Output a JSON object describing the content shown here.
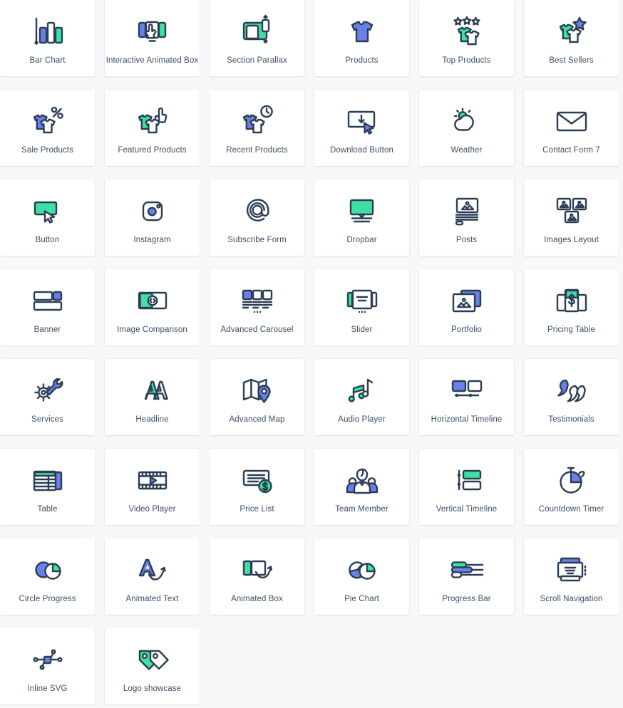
{
  "palette": {
    "page_background": "#f7f8fa",
    "card_background": "#ffffff",
    "stroke": "#2c3e55",
    "blue": "#6b7fe8",
    "green": "#3ee0a5",
    "label_text": "#3d4f66"
  },
  "grid": {
    "columns": 6,
    "card_count": 44
  },
  "cards": [
    {
      "label": "Bar Chart",
      "icon": "bar-chart-icon"
    },
    {
      "label": "Interactive Animated Box",
      "icon": "interactive-animated-box-icon"
    },
    {
      "label": "Section Parallax",
      "icon": "section-parallax-icon"
    },
    {
      "label": "Products",
      "icon": "products-tshirt-icon"
    },
    {
      "label": "Top Products",
      "icon": "top-products-stars-icon"
    },
    {
      "label": "Best Sellers",
      "icon": "best-sellers-star-icon"
    },
    {
      "label": "Sale Products",
      "icon": "sale-products-percent-icon"
    },
    {
      "label": "Featured Products",
      "icon": "featured-products-thumbsup-icon"
    },
    {
      "label": "Recent Products",
      "icon": "recent-products-clock-icon"
    },
    {
      "label": "Download Button",
      "icon": "download-button-icon"
    },
    {
      "label": "Weather",
      "icon": "weather-sun-cloud-icon"
    },
    {
      "label": "Contact Form 7",
      "icon": "envelope-icon"
    },
    {
      "label": "Button",
      "icon": "button-cursor-icon"
    },
    {
      "label": "Instagram",
      "icon": "instagram-camera-icon"
    },
    {
      "label": "Subscribe Form",
      "icon": "at-sign-icon"
    },
    {
      "label": "Dropbar",
      "icon": "dropbar-screen-icon"
    },
    {
      "label": "Posts",
      "icon": "posts-icon"
    },
    {
      "label": "Images Layout",
      "icon": "images-layout-icon"
    },
    {
      "label": "Banner",
      "icon": "banner-icon"
    },
    {
      "label": "Image Comparison",
      "icon": "image-comparison-icon"
    },
    {
      "label": "Advanced Carousel",
      "icon": "advanced-carousel-icon"
    },
    {
      "label": "Slider",
      "icon": "slider-icon"
    },
    {
      "label": "Portfolio",
      "icon": "portfolio-icon"
    },
    {
      "label": "Pricing Table",
      "icon": "pricing-table-icon"
    },
    {
      "label": "Services",
      "icon": "services-gear-wrench-icon"
    },
    {
      "label": "Headline",
      "icon": "headline-aa-icon"
    },
    {
      "label": "Advanced Map",
      "icon": "advanced-map-pin-icon"
    },
    {
      "label": "Audio Player",
      "icon": "audio-player-notes-icon"
    },
    {
      "label": "Horizontal Timeline",
      "icon": "horizontal-timeline-icon"
    },
    {
      "label": "Testimonials",
      "icon": "testimonials-quotes-icon"
    },
    {
      "label": "Table",
      "icon": "table-icon"
    },
    {
      "label": "Video Player",
      "icon": "video-player-film-icon"
    },
    {
      "label": "Price List",
      "icon": "price-list-dollar-icon"
    },
    {
      "label": "Team Member",
      "icon": "team-member-icon"
    },
    {
      "label": "Vertical Timeline",
      "icon": "vertical-timeline-icon"
    },
    {
      "label": "Countdown Timer",
      "icon": "countdown-timer-icon"
    },
    {
      "label": "Circle Progress",
      "icon": "circle-progress-icon"
    },
    {
      "label": "Animated Text",
      "icon": "animated-text-a-arrow-icon"
    },
    {
      "label": "Animated Box",
      "icon": "animated-box-arrow-icon"
    },
    {
      "label": "Pie Chart",
      "icon": "pie-chart-icon"
    },
    {
      "label": "Progress Bar",
      "icon": "progress-bar-icon"
    },
    {
      "label": "Scroll Navigation",
      "icon": "scroll-navigation-icon"
    },
    {
      "label": "Inline SVG",
      "icon": "inline-svg-node-icon"
    },
    {
      "label": "Logo showcase",
      "icon": "logo-showcase-tags-icon"
    }
  ]
}
